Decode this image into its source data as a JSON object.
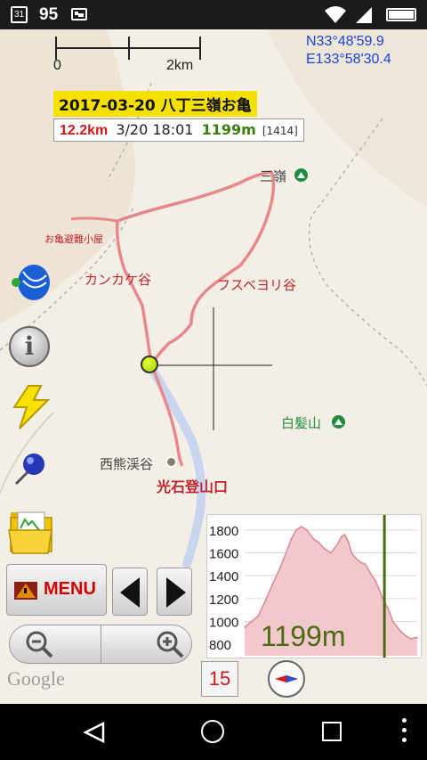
{
  "status_bar": {
    "calendar_day": "31",
    "battery_level": "95",
    "icons": [
      "calendar-icon",
      "gallery-icon",
      "wifi-icon",
      "signal-icon",
      "battery-icon"
    ]
  },
  "scale": {
    "start": "0",
    "end": "2km"
  },
  "coords": {
    "lat": "N33°48'59.9",
    "lon": "E133°58'30.4"
  },
  "track": {
    "title": "2017-03-20 八丁三嶺お亀",
    "distance": "12.2km",
    "datetime": "3/20 18:01",
    "altitude": "1199m",
    "point_count": "[1414]"
  },
  "map_labels": {
    "summit_name": "三嶺",
    "hut": "お亀避難小屋",
    "valley1": "カンカケ谷",
    "valley2": "フスベヨリ谷",
    "shiraga": "白髪山",
    "nishikuma": "西熊渓谷",
    "trailhead": "光石登山口"
  },
  "buttons": {
    "menu": "MENU",
    "zoom_level": "15"
  },
  "attribution": "Google",
  "elevation_chart": {
    "y_ticks": [
      "1800",
      "1600",
      "1400",
      "1200",
      "1000",
      "800"
    ],
    "current_altitude": "1199m"
  },
  "chart_data": {
    "type": "area",
    "title": "",
    "xlabel": "",
    "ylabel": "",
    "ylim": [
      700,
      1900
    ],
    "y_ticks": [
      1800,
      1600,
      1400,
      1200,
      1000,
      800
    ],
    "cursor_x": 0.81,
    "x": [
      0,
      0.04,
      0.08,
      0.12,
      0.16,
      0.2,
      0.24,
      0.27,
      0.3,
      0.33,
      0.36,
      0.38,
      0.4,
      0.43,
      0.46,
      0.5,
      0.54,
      0.56,
      0.58,
      0.6,
      0.62,
      0.64,
      0.67,
      0.7,
      0.73,
      0.76,
      0.78,
      0.8,
      0.83,
      0.86,
      0.9,
      0.93,
      0.96,
      1.0
    ],
    "values": [
      950,
      1000,
      1050,
      1180,
      1320,
      1450,
      1600,
      1720,
      1800,
      1830,
      1800,
      1760,
      1720,
      1690,
      1640,
      1600,
      1680,
      1740,
      1760,
      1700,
      1600,
      1560,
      1520,
      1500,
      1420,
      1350,
      1280,
      1200,
      1120,
      1000,
      920,
      880,
      850,
      860
    ],
    "colors": {
      "area": "#f2c8cc",
      "line": "#d98890",
      "cursor": "#4a6b12"
    }
  },
  "colors": {
    "track": "#e8888a",
    "coords": "#1844d8",
    "title_bg": "#f4e100",
    "altitude": "#3e7d12",
    "distance": "#d01818"
  }
}
